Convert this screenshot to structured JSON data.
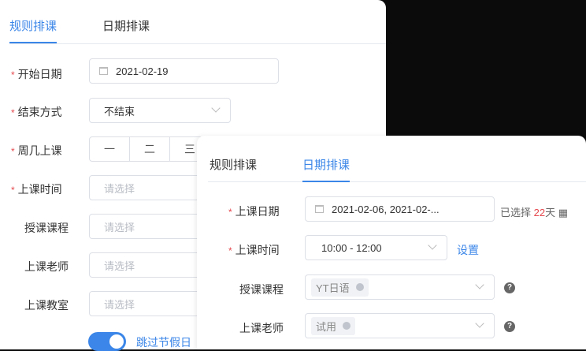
{
  "rule_panel": {
    "tabs": [
      {
        "label": "规则排课",
        "active": true
      },
      {
        "label": "日期排课",
        "active": false
      }
    ],
    "fields": [
      {
        "label": "开始日期",
        "required": true,
        "value": "2021-02-19"
      },
      {
        "label": "结束方式",
        "required": true,
        "value": "不结束"
      },
      {
        "label": "周几上课",
        "required": true,
        "weekdays": [
          "一",
          "二",
          "三"
        ]
      },
      {
        "label": "上课时间",
        "required": true,
        "placeholder": "请选择"
      },
      {
        "label": "授课课程",
        "required": false,
        "placeholder": "请选择"
      },
      {
        "label": "上课老师",
        "required": false,
        "placeholder": "请选择"
      },
      {
        "label": "上课教室",
        "required": false,
        "placeholder": "请选择"
      }
    ],
    "skip_holidays": {
      "label": "跳过节假日",
      "on": true
    }
  },
  "date_panel": {
    "tabs": [
      {
        "label": "规则排课",
        "active": false
      },
      {
        "label": "日期排课",
        "active": true
      }
    ],
    "fields": [
      {
        "label": "上课日期",
        "required": true,
        "value": "2021-02-06, 2021-02-...",
        "selected_prefix": "已选择",
        "selected_count": "22",
        "selected_suffix": "天"
      },
      {
        "label": "上课时间",
        "required": true,
        "value": "10:00 - 12:00",
        "action": "设置"
      },
      {
        "label": "授课课程",
        "required": false,
        "tag": "YT日语"
      },
      {
        "label": "上课老师",
        "required": false,
        "tag": "试用"
      }
    ],
    "help_icon": "?"
  },
  "colors": {
    "accent": "#3b86e8",
    "required": "#e5484d"
  }
}
